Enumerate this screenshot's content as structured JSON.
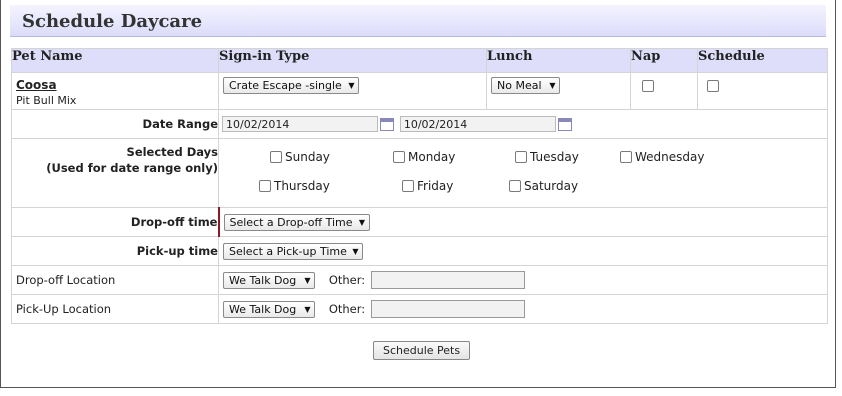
{
  "title": "Schedule Daycare",
  "columns": [
    "Pet Name",
    "Sign-in Type",
    "Lunch",
    "Nap",
    "Schedule"
  ],
  "pet": {
    "name": "Coosa",
    "breed": "Pit Bull Mix"
  },
  "sign_in_type": "Crate Escape -single",
  "lunch": "No Meal",
  "date_range": {
    "label": "Date Range",
    "start": "10/02/2014",
    "end": "10/02/2014"
  },
  "selected_days": {
    "label_line1": "Selected Days",
    "label_line2": "(Used for date range only)",
    "days": [
      "Sunday",
      "Monday",
      "Tuesday",
      "Wednesday",
      "Thursday",
      "Friday",
      "Saturday"
    ]
  },
  "dropoff_time": {
    "label": "Drop-off time",
    "value": "Select a Drop-off Time"
  },
  "pickup_time": {
    "label": "Pick-up time",
    "value": "Select a Pick-up Time"
  },
  "dropoff_location": {
    "label": "Drop-off Location",
    "value": "We Talk Dog",
    "other_label": "Other:"
  },
  "pickup_location": {
    "label": "Pick-Up Location",
    "value": "We Talk Dog",
    "other_label": "Other:"
  },
  "submit_label": "Schedule Pets",
  "icons": {
    "dropdown": "chevron-down-icon",
    "calendar": "calendar-icon"
  }
}
